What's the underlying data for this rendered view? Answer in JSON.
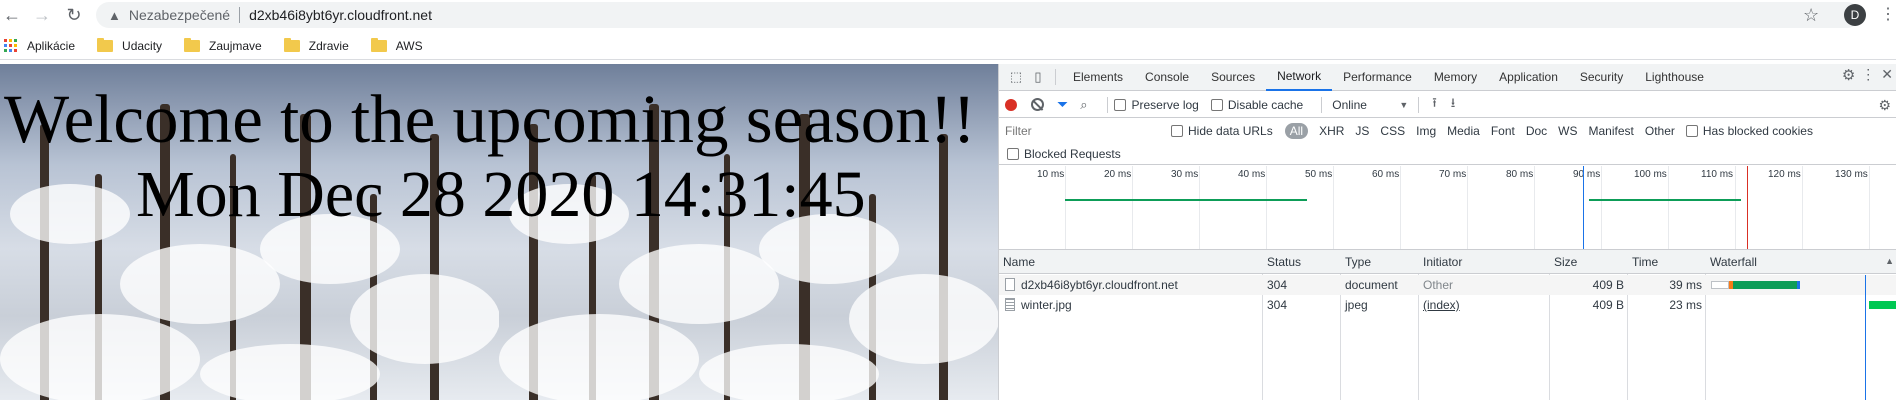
{
  "browser": {
    "security_label": "Nezabezpečené",
    "url": "d2xb46i8ybt6yr.cloudfront.net",
    "avatar_letter": "D"
  },
  "bookmarks": {
    "items": [
      {
        "label": "Aplikácie",
        "icon": "apps-grid-icon"
      },
      {
        "label": "Udacity",
        "icon": "folder-icon"
      },
      {
        "label": "Zaujmave",
        "icon": "folder-icon"
      },
      {
        "label": "Zdravie",
        "icon": "folder-icon"
      },
      {
        "label": "AWS",
        "icon": "folder-icon"
      }
    ]
  },
  "page": {
    "heading": "Welcome to the upcoming season!!",
    "datetime": "Mon Dec 28 2020 14:31:45",
    "background_image": "winter.jpg"
  },
  "devtools": {
    "tabs": [
      "Elements",
      "Console",
      "Sources",
      "Network",
      "Performance",
      "Memory",
      "Application",
      "Security",
      "Lighthouse"
    ],
    "active_tab": "Network",
    "toolbar": {
      "preserve_log": "Preserve log",
      "disable_cache": "Disable cache",
      "throttling": "Online"
    },
    "filter": {
      "placeholder": "Filter",
      "hide_data_urls": "Hide data URLs",
      "types": [
        "All",
        "XHR",
        "JS",
        "CSS",
        "Img",
        "Media",
        "Font",
        "Doc",
        "WS",
        "Manifest",
        "Other"
      ],
      "has_blocked_cookies": "Has blocked cookies",
      "blocked_requests": "Blocked Requests"
    },
    "overview": {
      "ticks": [
        "10 ms",
        "20 ms",
        "30 ms",
        "40 ms",
        "50 ms",
        "60 ms",
        "70 ms",
        "80 ms",
        "90 ms",
        "100 ms",
        "110 ms",
        "120 ms",
        "130 ms"
      ]
    },
    "table": {
      "headers": {
        "name": "Name",
        "status": "Status",
        "type": "Type",
        "initiator": "Initiator",
        "size": "Size",
        "time": "Time",
        "waterfall": "Waterfall"
      },
      "rows": [
        {
          "name": "d2xb46i8ybt6yr.cloudfront.net",
          "status": "304",
          "type": "document",
          "initiator": "Other",
          "size": "409 B",
          "time": "39 ms"
        },
        {
          "name": "winter.jpg",
          "status": "304",
          "type": "jpeg",
          "initiator": "(index)",
          "size": "409 B",
          "time": "23 ms"
        }
      ]
    },
    "colors": {
      "accent": "#1a73e8",
      "record": "#d93025",
      "waterfall_green": "#0d9d58",
      "waterfall_teal": "#00c853"
    }
  }
}
